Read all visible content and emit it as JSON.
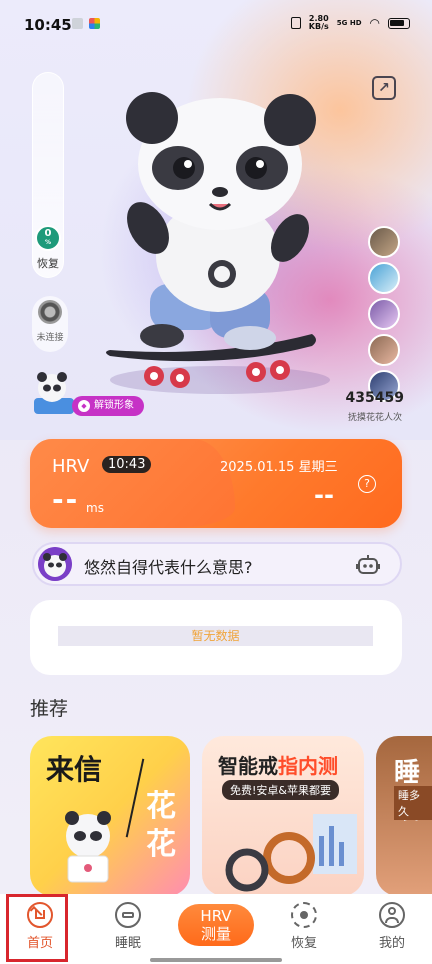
{
  "status_bar": {
    "time": "10:45",
    "net_speed_value": "2.80",
    "net_speed_unit": "KB/s",
    "network": "5G HD"
  },
  "recovery": {
    "value": "0",
    "unit": "%",
    "label": "恢复"
  },
  "device": {
    "label": "未连接"
  },
  "hero": {
    "unlock_label": "解锁形象",
    "pet_count": "435459",
    "pet_count_label": "抚摸花花人次"
  },
  "hrv_card": {
    "title": "HRV",
    "time": "10:43",
    "date": "2025.01.15 星期三",
    "value": "--",
    "unit": "ms",
    "secondary_value": "--",
    "help_symbol": "?"
  },
  "ai_question": {
    "text": "悠然自得代表什么意思?"
  },
  "data_card": {
    "placeholder": "暂无数据"
  },
  "recommend": {
    "title": "推荐",
    "cards": [
      {
        "title": "来信",
        "subtitle": "花花"
      },
      {
        "title_a": "智能戒",
        "title_b": "指内测",
        "subtitle": "免费!安卓&苹果都要"
      },
      {
        "title": "睡眠",
        "subtitle": "睡多久"
      }
    ]
  },
  "nav": {
    "home": "首页",
    "sleep": "睡眠",
    "hrv_line1": "HRV",
    "hrv_line2": "测量",
    "recover": "恢复",
    "mine": "我的"
  },
  "colors": {
    "accent_orange": "#ff7a2c",
    "recovery_green": "#1e9a7a",
    "unlock_purple": "#c632c6",
    "active_nav": "#e2562d"
  }
}
